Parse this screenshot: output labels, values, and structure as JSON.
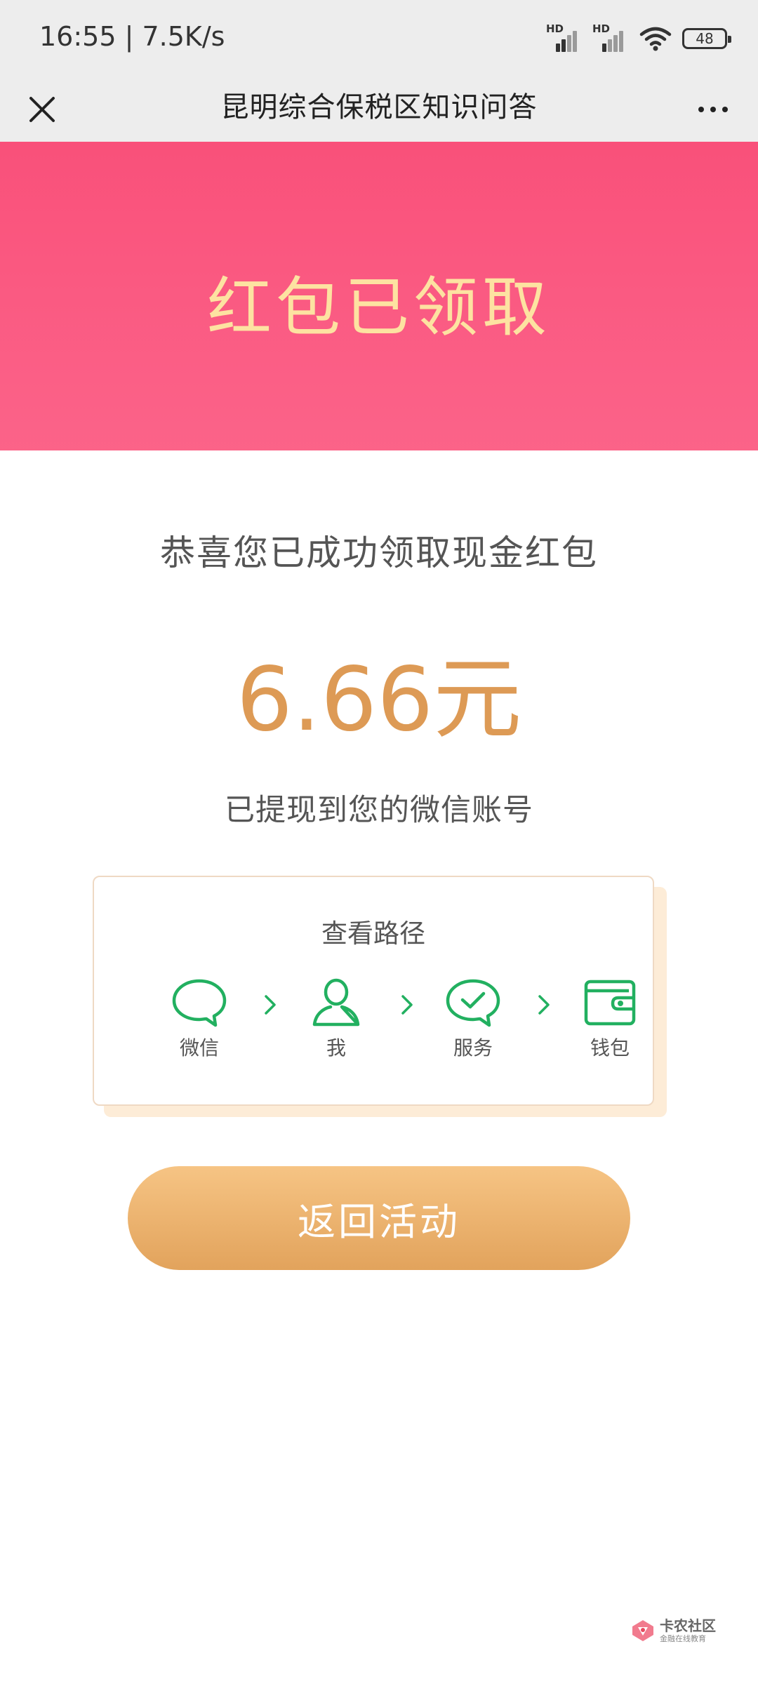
{
  "status_bar": {
    "time_speed": "16:55 | 7.5K/s",
    "sim1_label": "HD",
    "sim2_label": "HD",
    "battery": "48"
  },
  "nav": {
    "title": "昆明综合保税区知识问答",
    "close_icon": "close-icon",
    "more_icon": "more-icon"
  },
  "header": {
    "title": "红包已领取"
  },
  "main": {
    "congrats": "恭喜您已成功领取现金红包",
    "amount": "6.66元",
    "withdraw_note": "已提现到您的微信账号"
  },
  "path_card": {
    "title": "查看路径",
    "steps": [
      {
        "label": "微信",
        "icon": "chat-bubble-icon"
      },
      {
        "label": "我",
        "icon": "person-icon"
      },
      {
        "label": "服务",
        "icon": "check-bubble-icon"
      },
      {
        "label": "钱包",
        "icon": "wallet-icon"
      }
    ]
  },
  "return_button": {
    "label": "返回活动"
  },
  "watermark": {
    "name": "卡农社区",
    "subtitle": "金融在线教育"
  },
  "colors": {
    "header_pink": "#f7426e",
    "header_text": "#fde2a1",
    "amount": "#dd9a55",
    "icon_green": "#22b060",
    "button_gold": "#e8ac66"
  }
}
